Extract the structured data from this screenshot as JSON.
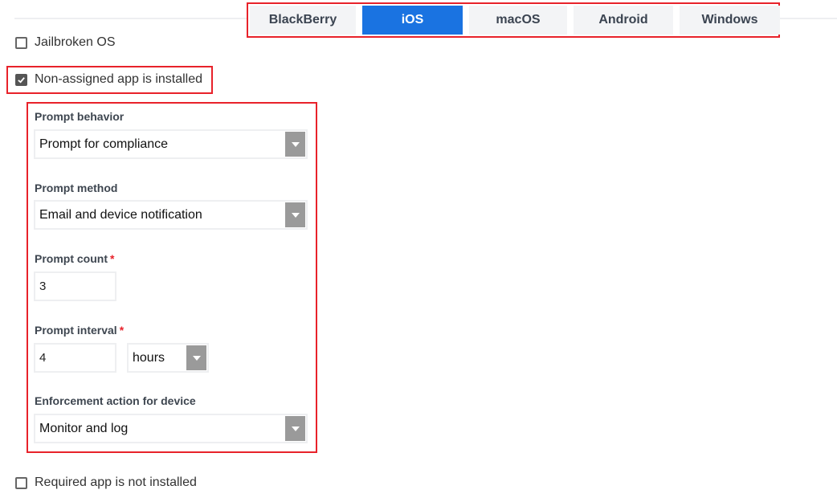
{
  "tabs": [
    {
      "label": "BlackBerry",
      "active": false
    },
    {
      "label": "iOS",
      "active": true
    },
    {
      "label": "macOS",
      "active": false
    },
    {
      "label": "Android",
      "active": false
    },
    {
      "label": "Windows",
      "active": false
    }
  ],
  "checkboxes": {
    "jailbroken": {
      "label": "Jailbroken OS",
      "checked": false
    },
    "non_assigned": {
      "label": "Non-assigned app is installed",
      "checked": true
    },
    "required_app": {
      "label": "Required app is not installed",
      "checked": false
    }
  },
  "form": {
    "prompt_behavior": {
      "label": "Prompt behavior",
      "value": "Prompt for compliance"
    },
    "prompt_method": {
      "label": "Prompt method",
      "value": "Email and device notification"
    },
    "prompt_count": {
      "label": "Prompt count",
      "required_mark": "*",
      "value": "3"
    },
    "prompt_interval": {
      "label": "Prompt interval",
      "required_mark": "*",
      "value": "4",
      "unit": "hours"
    },
    "enforcement_action": {
      "label": "Enforcement action for device",
      "value": "Monitor and log"
    }
  },
  "colors": {
    "accent": "#1a73e1",
    "highlight": "#e8222a",
    "required": "#e8222a"
  }
}
